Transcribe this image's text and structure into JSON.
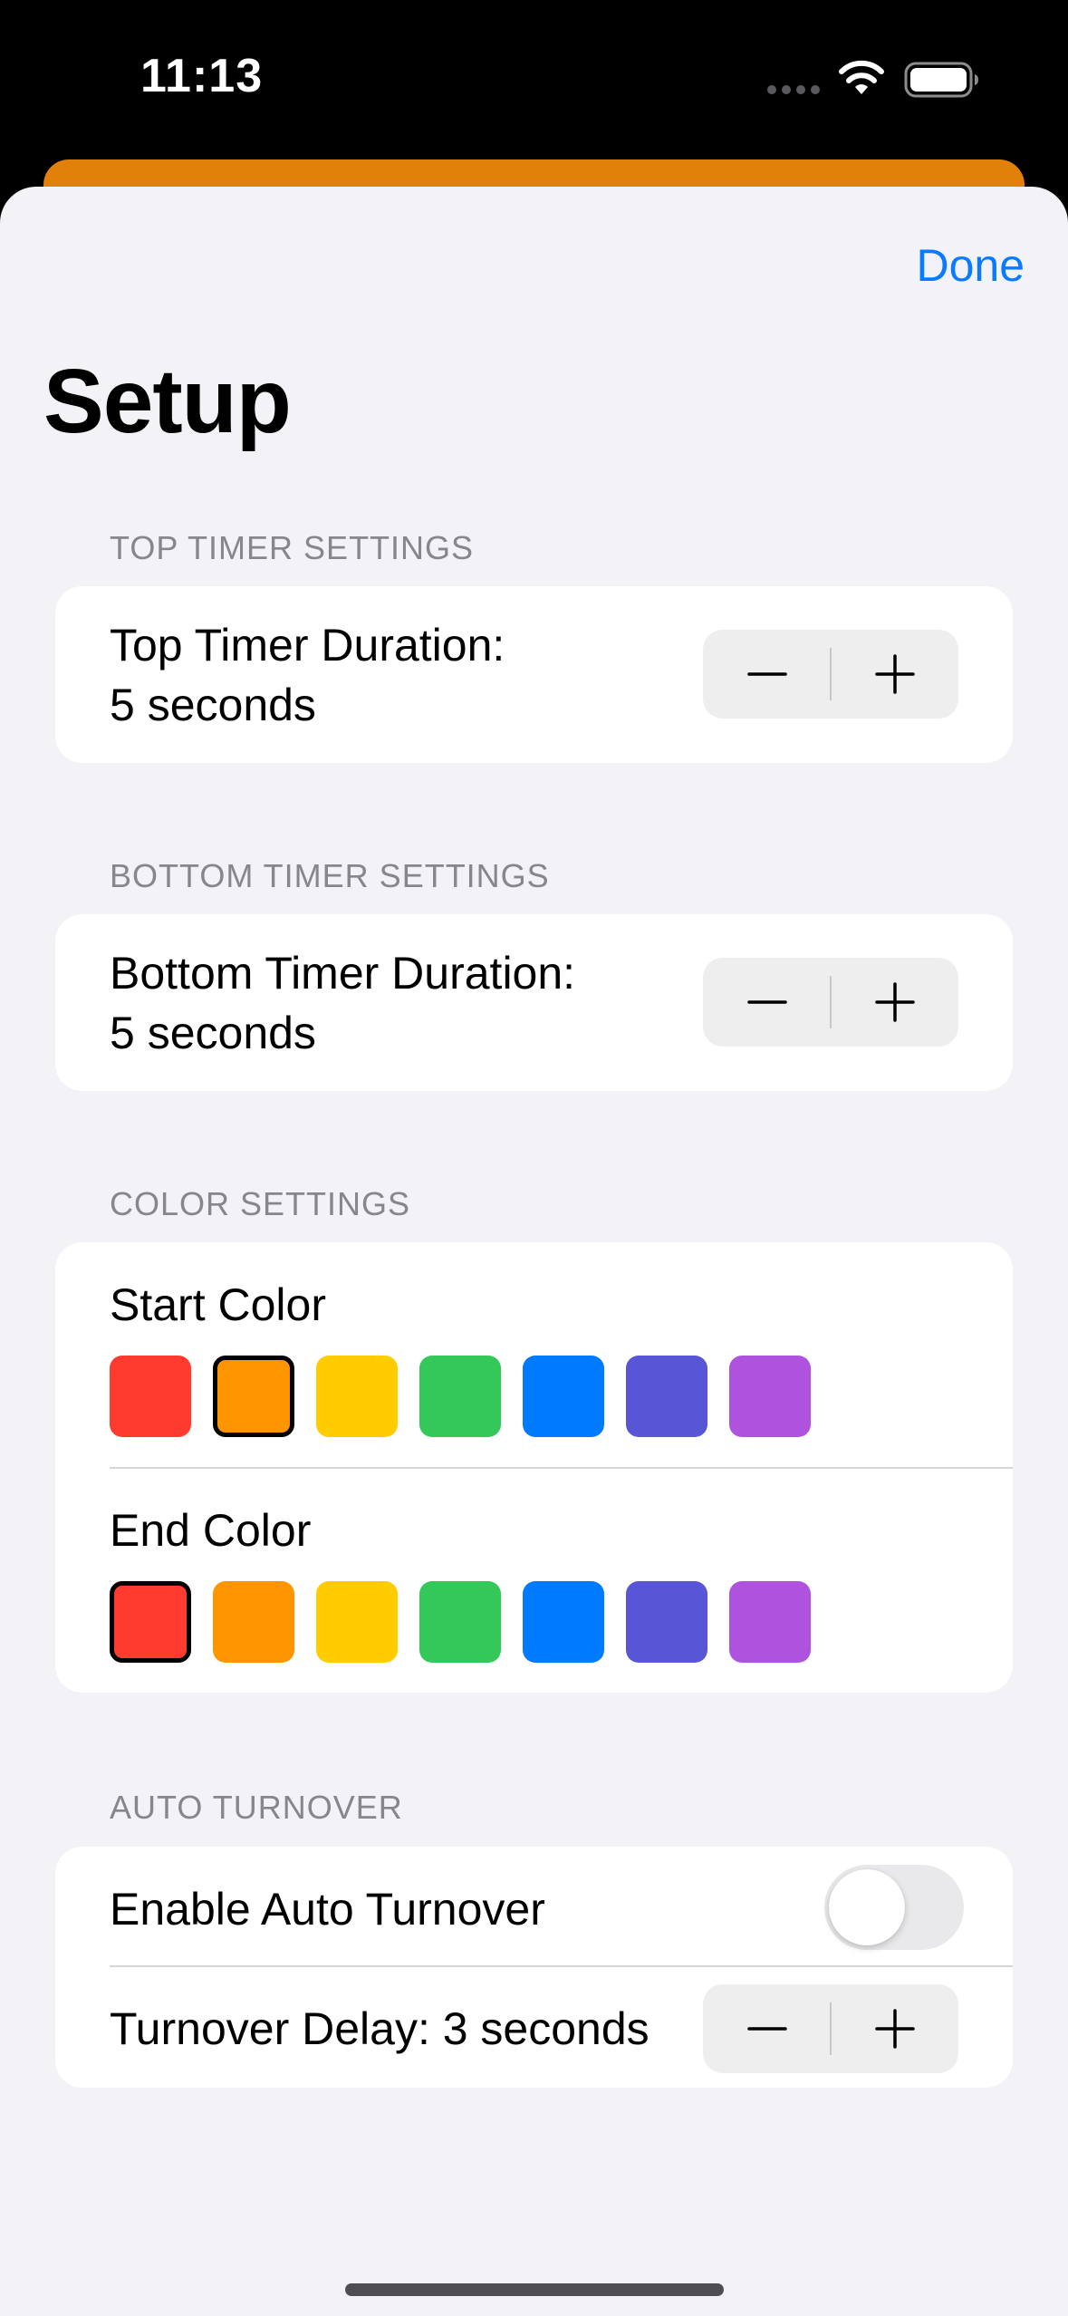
{
  "status_bar": {
    "time": "11:13",
    "icons": [
      "signal-dots-icon",
      "wifi-icon",
      "battery-icon"
    ]
  },
  "nav": {
    "done_label": "Done",
    "title": "Setup"
  },
  "sections": {
    "top_timer": {
      "header": "TOP TIMER SETTINGS",
      "label_line1": "Top Timer Duration:",
      "label_line2": "5 seconds"
    },
    "bottom_timer": {
      "header": "BOTTOM TIMER SETTINGS",
      "label_line1": "Bottom Timer Duration:",
      "label_line2": "5 seconds"
    },
    "color": {
      "header": "COLOR SETTINGS",
      "start_label": "Start Color",
      "end_label": "End Color",
      "palette": [
        "#FF3B30",
        "#FF9500",
        "#FFCC00",
        "#34C759",
        "#007AFF",
        "#5856D6",
        "#AF52DE"
      ],
      "start_selected_index": 1,
      "end_selected_index": 0
    },
    "auto_turnover": {
      "header": "AUTO TURNOVER",
      "enable_label": "Enable Auto Turnover",
      "enabled": false,
      "delay_label": "Turnover Delay: 3 seconds"
    }
  },
  "colors": {
    "accent": "#0A7AFF",
    "backdrop_card": "#E1810A",
    "sheet_background": "#F2F2F7"
  }
}
